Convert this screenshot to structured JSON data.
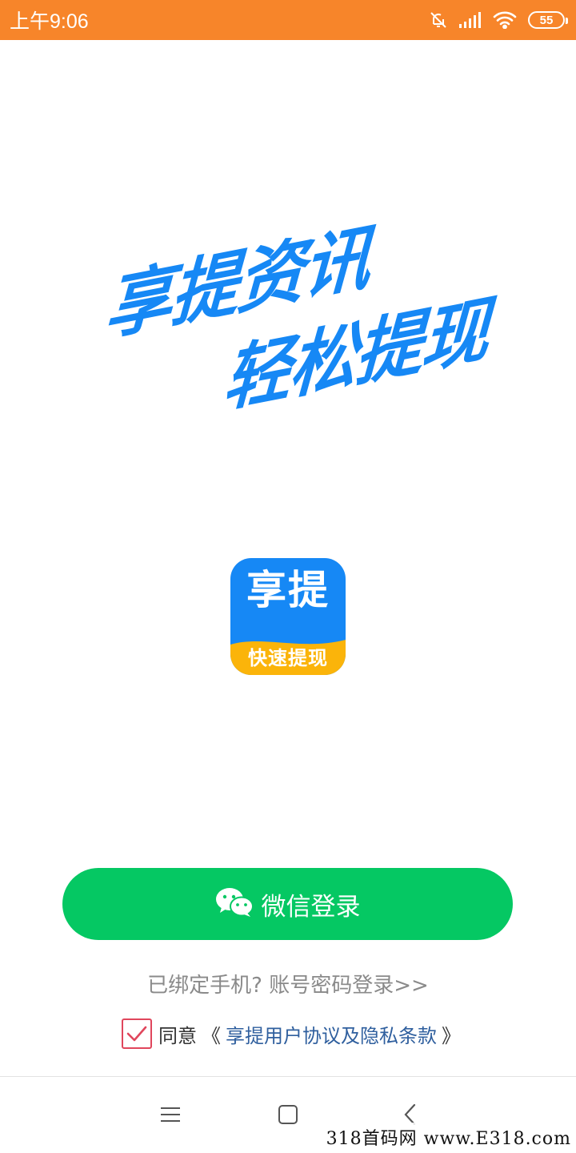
{
  "status_bar": {
    "time": "上午9:06",
    "battery": "55",
    "icons": [
      "notifications-muted-icon",
      "signal-icon",
      "wifi-icon",
      "battery-icon"
    ],
    "background_color": "#f7852a"
  },
  "slogan": {
    "line1": "享提资讯",
    "line2": "轻松提现",
    "color": "#1688f5"
  },
  "app_logo": {
    "title": "享提",
    "subtitle": "快速提现",
    "primary_color": "#1688f5",
    "band_color": "#fbb40a"
  },
  "login": {
    "wechat_label": "微信登录",
    "wechat_icon": "wechat-icon",
    "wechat_color": "#05c863",
    "account_login_label": "已绑定手机? 账号密码登录>>"
  },
  "agreement": {
    "checked": true,
    "prefix": "同意",
    "open_bracket": "《",
    "link_text": "享提用户协议及隐私条款",
    "close_bracket": "》"
  },
  "nav_bar": {
    "icons": [
      "menu-icon",
      "home-icon",
      "back-icon"
    ]
  },
  "watermark": {
    "text": "318首码网 www.E318.com"
  }
}
